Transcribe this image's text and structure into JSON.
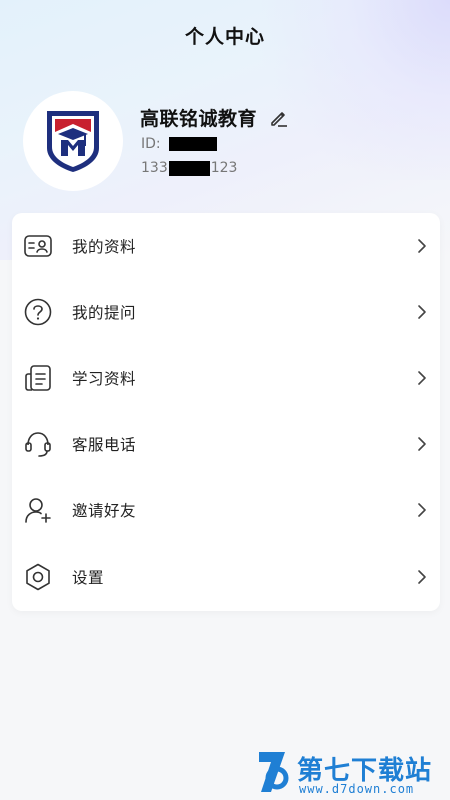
{
  "header": {
    "title": "个人中心"
  },
  "profile": {
    "name": "高联铭诚教育",
    "id_label": "ID:",
    "phone_prefix": "133",
    "phone_suffix": "123"
  },
  "menu": {
    "items": [
      {
        "label": "我的资料",
        "icon": "profile-card-icon"
      },
      {
        "label": "我的提问",
        "icon": "question-circle-icon"
      },
      {
        "label": "学习资料",
        "icon": "document-icon"
      },
      {
        "label": "客服电话",
        "icon": "headset-icon"
      },
      {
        "label": "邀请好友",
        "icon": "add-user-icon"
      },
      {
        "label": "设置",
        "icon": "gear-icon"
      }
    ]
  },
  "watermark": {
    "title": "第七下载站",
    "url": "www.d7down.com"
  },
  "colors": {
    "accent": "#1f7fd4",
    "text": "#222222",
    "muted": "#777777"
  }
}
